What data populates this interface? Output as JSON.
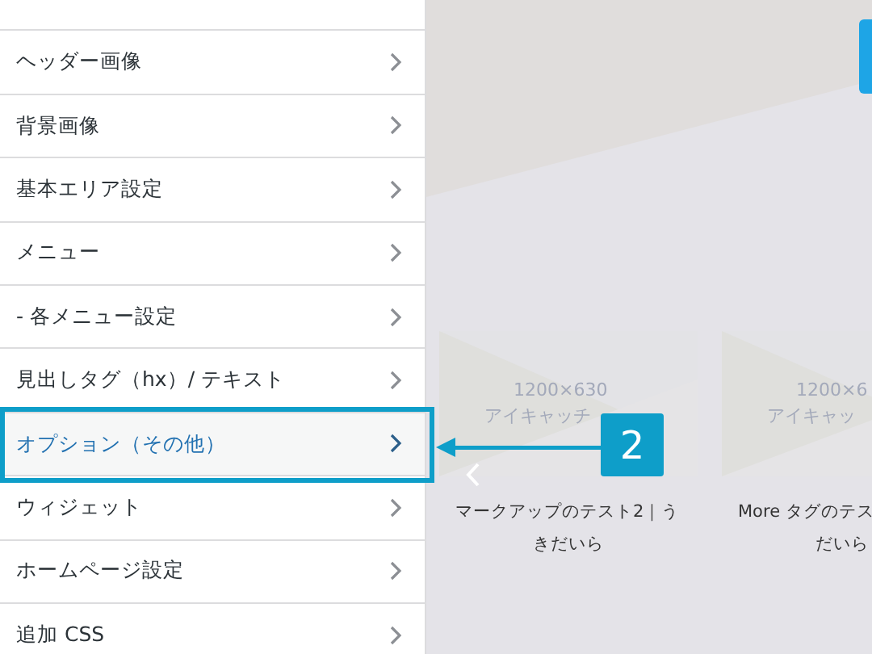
{
  "sidebar": {
    "items": [
      {
        "label": "ヘッダー画像",
        "selected": false
      },
      {
        "label": "背景画像",
        "selected": false
      },
      {
        "label": "基本エリア設定",
        "selected": false
      },
      {
        "label": "メニュー",
        "selected": false
      },
      {
        "label": "- 各メニュー設定",
        "selected": false
      },
      {
        "label": "見出しタグ（hx）/ テキスト",
        "selected": false
      },
      {
        "label": "オプション（その他）",
        "selected": true
      },
      {
        "label": "ウィジェット",
        "selected": false
      },
      {
        "label": "ホームページ設定",
        "selected": false
      },
      {
        "label": "追加 CSS",
        "selected": false
      }
    ]
  },
  "preview": {
    "cards": [
      {
        "image_text": [
          "1200×630",
          "アイキャッチ"
        ],
        "caption": [
          "マークアップのテスト2｜う",
          "きだいら"
        ]
      },
      {
        "image_text": [
          "1200×6",
          "アイキャッ"
        ],
        "caption": [
          "More タグのテス",
          "だいら"
        ]
      }
    ]
  },
  "annotation": {
    "number": "2"
  }
}
